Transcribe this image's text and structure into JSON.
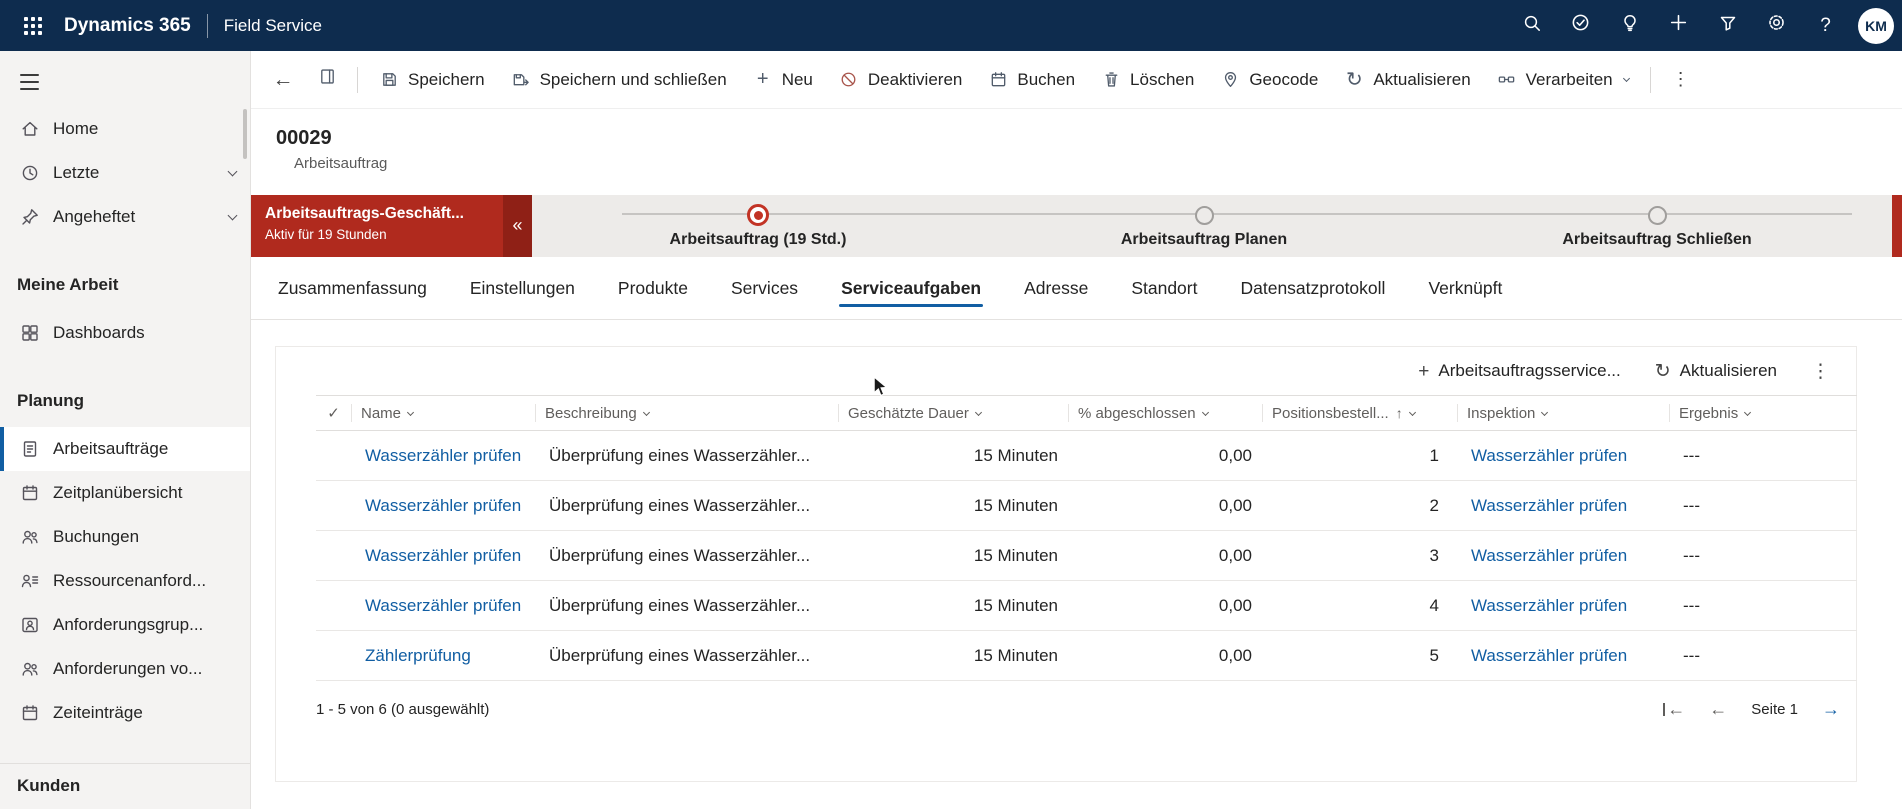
{
  "topbar": {
    "brand": "Dynamics 365",
    "app": "Field Service",
    "avatar": "KM"
  },
  "icons": {
    "back": "←",
    "forward": "→",
    "refresh": "↻",
    "more": "⋮",
    "plus": "+",
    "help": "?",
    "check": "✓",
    "sort_asc": "↑",
    "collapse": "«"
  },
  "command_bar": {
    "items": [
      {
        "label": "Speichern"
      },
      {
        "label": "Speichern und schließen"
      },
      {
        "label": "Neu"
      },
      {
        "label": "Deaktivieren"
      },
      {
        "label": "Buchen"
      },
      {
        "label": "Löschen"
      },
      {
        "label": "Geocode"
      },
      {
        "label": "Aktualisieren"
      },
      {
        "label": "Verarbeiten"
      }
    ]
  },
  "sidebar": {
    "top": [
      {
        "label": "Home"
      },
      {
        "label": "Letzte"
      },
      {
        "label": "Angeheftet"
      }
    ],
    "section1": {
      "header": "Meine Arbeit",
      "items": [
        {
          "label": "Dashboards"
        }
      ]
    },
    "section2": {
      "header": "Planung",
      "items": [
        {
          "label": "Arbeitsaufträge"
        },
        {
          "label": "Zeitplanübersicht"
        },
        {
          "label": "Buchungen"
        },
        {
          "label": "Ressourcenanford..."
        },
        {
          "label": "Anforderungsgrup..."
        },
        {
          "label": "Anforderungen vo..."
        },
        {
          "label": "Zeiteinträge"
        }
      ]
    },
    "section3": {
      "header": "Kunden"
    }
  },
  "record": {
    "id": "00029",
    "type": "Arbeitsauftrag"
  },
  "bpf": {
    "banner_title": "Arbeitsauftrags-Geschäft...",
    "banner_subtitle": "Aktiv für 19 Stunden",
    "stages": [
      {
        "label": "Arbeitsauftrag  (19 Std.)"
      },
      {
        "label": "Arbeitsauftrag Planen"
      },
      {
        "label": "Arbeitsauftrag Schließen"
      }
    ]
  },
  "tabs": {
    "items": [
      "Zusammenfassung",
      "Einstellungen",
      "Produkte",
      "Services",
      "Serviceaufgaben",
      "Adresse",
      "Standort",
      "Datensatzprotokoll",
      "Verknüpft"
    ],
    "active": "Serviceaufgaben"
  },
  "grid": {
    "add_label": "Arbeitsauftragsservice...",
    "refresh_label": "Aktualisieren",
    "columns": {
      "name": "Name",
      "beschreibung": "Beschreibung",
      "dauer": "Geschätzte Dauer",
      "abgeschlossen": "% abgeschlossen",
      "position": "Positionsbestell...",
      "inspektion": "Inspektion",
      "ergebnis": "Ergebnis"
    },
    "rows": [
      {
        "name": "Wasserzähler prüfen",
        "beschreibung": "Überprüfung eines Wasserzähler...",
        "dauer": "15 Minuten",
        "abgeschlossen": "0,00",
        "position": "1",
        "inspektion": "Wasserzähler prüfen",
        "ergebnis": "---"
      },
      {
        "name": "Wasserzähler prüfen",
        "beschreibung": "Überprüfung eines Wasserzähler...",
        "dauer": "15 Minuten",
        "abgeschlossen": "0,00",
        "position": "2",
        "inspektion": "Wasserzähler prüfen",
        "ergebnis": "---"
      },
      {
        "name": "Wasserzähler prüfen",
        "beschreibung": "Überprüfung eines Wasserzähler...",
        "dauer": "15 Minuten",
        "abgeschlossen": "0,00",
        "position": "3",
        "inspektion": "Wasserzähler prüfen",
        "ergebnis": "---"
      },
      {
        "name": "Wasserzähler prüfen",
        "beschreibung": "Überprüfung eines Wasserzähler...",
        "dauer": "15 Minuten",
        "abgeschlossen": "0,00",
        "position": "4",
        "inspektion": "Wasserzähler prüfen",
        "ergebnis": "---"
      },
      {
        "name": "Zählerprüfung",
        "beschreibung": "Überprüfung eines Wasserzähler...",
        "dauer": "15 Minuten",
        "abgeschlossen": "0,00",
        "position": "5",
        "inspektion": "Wasserzähler prüfen",
        "ergebnis": "---"
      }
    ],
    "footer": "1 - 5 von 6 (0 ausgewählt)",
    "page": "Seite 1"
  },
  "colors": {
    "accent": "#115ea3",
    "topbar": "#0e2c4e",
    "process_red": "#b02a1e"
  }
}
